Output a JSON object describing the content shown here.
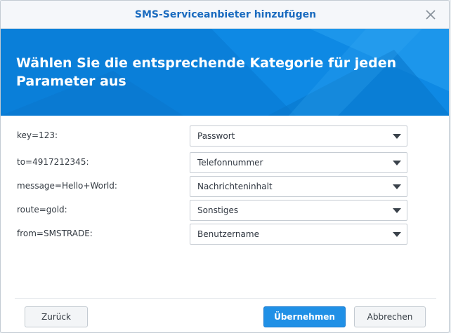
{
  "dialog": {
    "title": "SMS-Serviceanbieter hinzufügen",
    "heading": "Wählen Sie die entsprechende Kategorie für jeden Parameter aus"
  },
  "parameters": [
    {
      "label": "key=123:",
      "category": "Passwort"
    },
    {
      "label": "to=4917212345:",
      "category": "Telefonnummer"
    },
    {
      "label": "message=Hello+World:",
      "category": "Nachrichteninhalt"
    },
    {
      "label": "route=gold:",
      "category": "Sonstiges"
    },
    {
      "label": "from=SMSTRADE:",
      "category": "Benutzername"
    }
  ],
  "buttons": {
    "back": "Zurück",
    "apply": "Übernehmen",
    "cancel": "Abbrechen"
  },
  "icons": {
    "close": "close-icon",
    "dropdown": "chevron-down-icon"
  },
  "colors": {
    "title": "#1a6bbf",
    "banner": "#0d80d8",
    "primary_button": "#2090e6"
  }
}
